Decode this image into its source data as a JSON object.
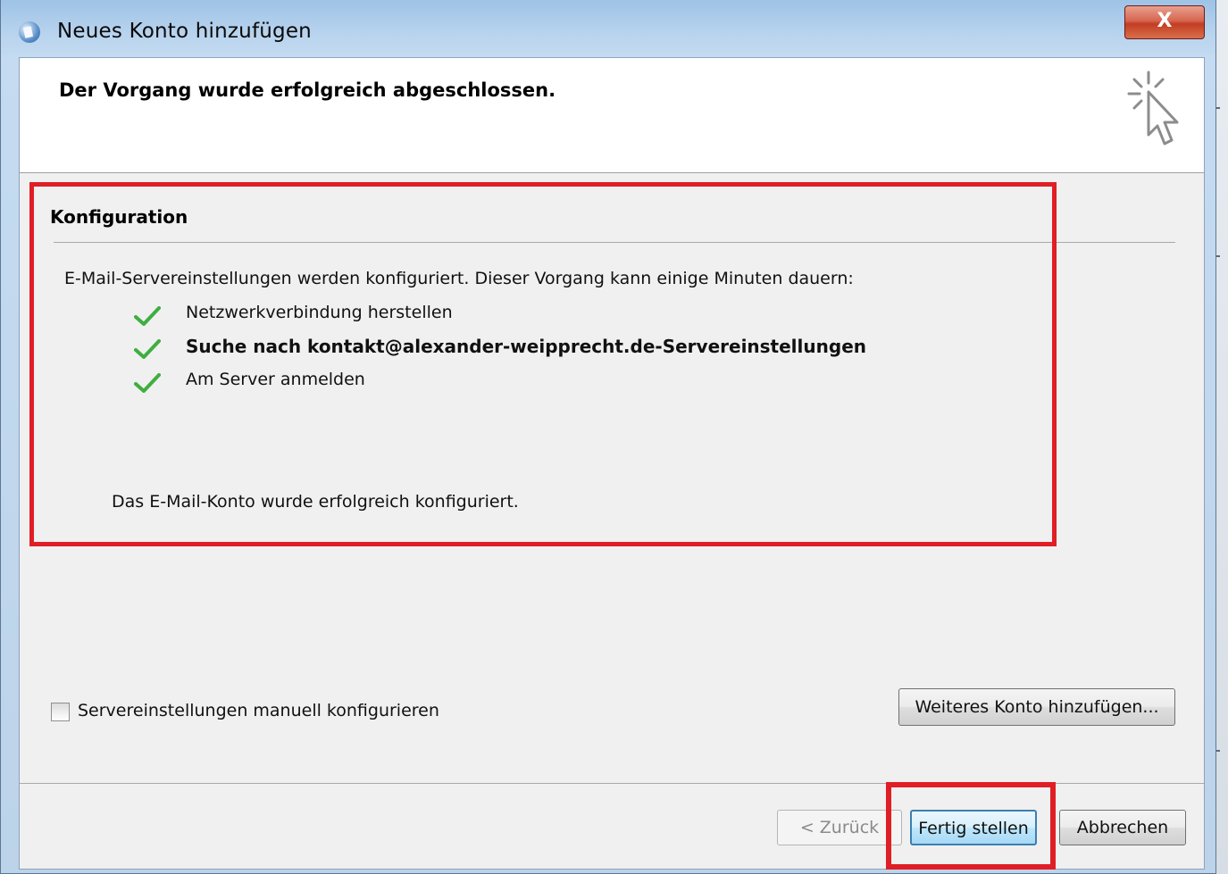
{
  "window": {
    "title": "Neues Konto hinzufügen",
    "close_label": "X"
  },
  "header": {
    "title": "Der Vorgang wurde erfolgreich abgeschlossen."
  },
  "section": {
    "title": "Konfiguration",
    "intro": "E-Mail-Servereinstellungen werden konfiguriert. Dieser Vorgang kann einige Minuten dauern:",
    "steps": [
      {
        "label": "Netzwerkverbindung herstellen",
        "status": "done",
        "bold": false
      },
      {
        "label": "Suche nach kontakt@alexander-weipprecht.de-Servereinstellungen",
        "status": "done",
        "bold": true
      },
      {
        "label": "Am Server anmelden",
        "status": "done",
        "bold": false
      }
    ],
    "success_message": "Das E-Mail-Konto wurde erfolgreich konfiguriert."
  },
  "manual_config": {
    "label": "Servereinstellungen manuell konfigurieren",
    "checked": false
  },
  "buttons": {
    "add_another": "Weiteres Konto hinzufügen...",
    "back": "< Zurück",
    "finish": "Fertig stellen",
    "cancel": "Abbrechen"
  },
  "colors": {
    "highlight": "#e01e26",
    "checkmark": "#3fae3f"
  }
}
